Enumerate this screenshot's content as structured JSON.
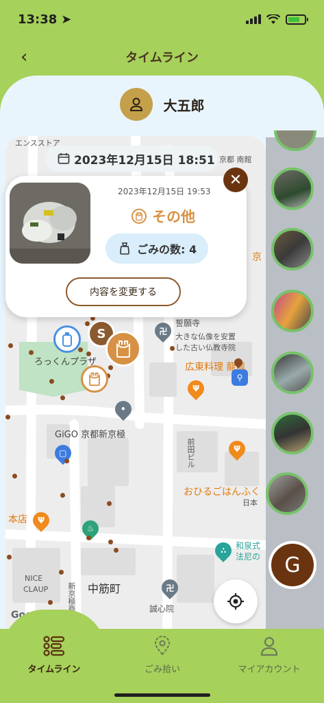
{
  "status_bar": {
    "time": "13:38"
  },
  "header": {
    "title": "タイムライン",
    "back_icon": "chevron-left-icon"
  },
  "user": {
    "name": "大五郎"
  },
  "map": {
    "labels": {
      "store_top": "エンスストア",
      "temple_top": "京都 南館",
      "park": "ろっくんプラザ",
      "seiganji": "誓願寺",
      "seiganji_desc1": "大きな仏像を安置",
      "seiganji_desc2": "した古い仏教寺院",
      "kanton": "広東料理 龍鳳",
      "gigo": "GiGO 京都新京極",
      "maeda": "前田ビル",
      "ohiru": "おひるごはんふく",
      "nihon": "日本",
      "honten": "本店",
      "nice": "NICE",
      "claup": "CLAUP",
      "nakasuji": "中筋町",
      "seishinin": "誠心院",
      "izumishiki1": "和泉式",
      "izumishiki2": "法尼の",
      "street": "新京極商店街",
      "kyo": "京",
      "google": "Google"
    }
  },
  "popup": {
    "date_chip": "2023年12月15日 18:51",
    "timestamp": "2023年12月15日 19:53",
    "category": "その他",
    "count_label": "ごみの数: 4",
    "change_button": "内容を変更する",
    "marker_s": "S"
  },
  "fab": {
    "profile_initial": "G"
  },
  "nav": {
    "items": [
      {
        "label": "タイムライン",
        "icon": "timeline-icon"
      },
      {
        "label": "ごみ拾い",
        "icon": "map-pin-icon"
      },
      {
        "label": "マイアカウント",
        "icon": "person-icon"
      }
    ]
  },
  "colors": {
    "brand_green": "#a6d15a",
    "accent_brown": "#6a3410",
    "category_orange": "#d79145",
    "thumb_ring": "#77c26a"
  }
}
